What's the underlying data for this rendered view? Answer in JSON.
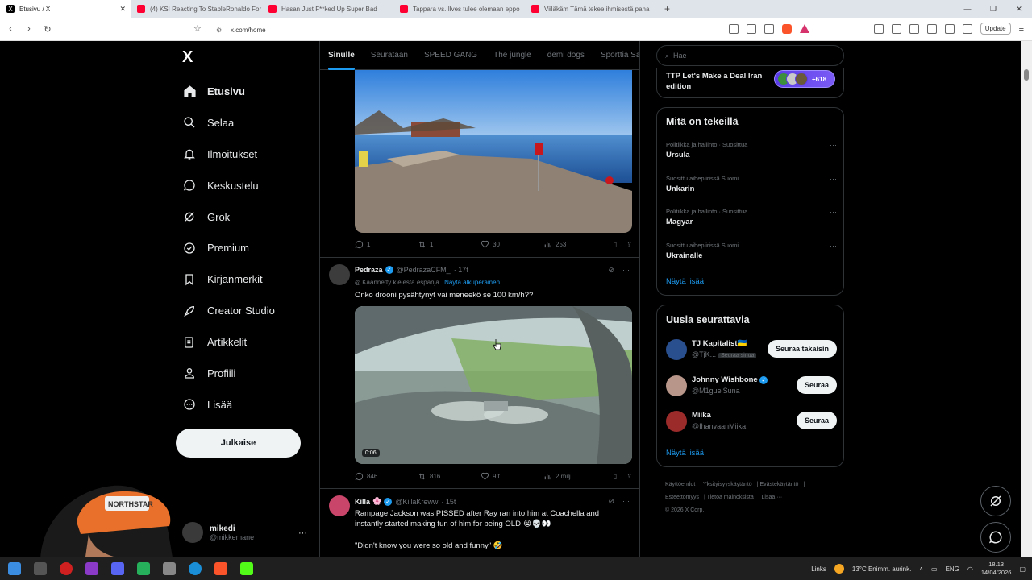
{
  "browser": {
    "tabs": [
      {
        "title": "Etusivu / X",
        "icon": "x-icon",
        "active": true
      },
      {
        "title": "(4) KSI Reacting To StableRonaldo For",
        "icon": "youtube-icon"
      },
      {
        "title": "Hasan Just F**ked Up Super Bad",
        "icon": "youtube-icon"
      },
      {
        "title": "Tappara vs. Ilves tulee olemaan eppo",
        "icon": "youtube-icon"
      },
      {
        "title": "Viiläkäm Tämä tekee ihmisestä paha",
        "icon": "youtube-icon"
      }
    ],
    "url": "x.com/home",
    "update_label": "Update"
  },
  "sidebar": {
    "logo": "X",
    "items": [
      {
        "label": "Etusivu",
        "icon": "home-icon"
      },
      {
        "label": "Selaa",
        "icon": "search-icon"
      },
      {
        "label": "Ilmoitukset",
        "icon": "bell-icon"
      },
      {
        "label": "Keskustelu",
        "icon": "chat-icon"
      },
      {
        "label": "Grok",
        "icon": "grok-icon"
      },
      {
        "label": "Premium",
        "icon": "premium-icon"
      },
      {
        "label": "Kirjanmerkit",
        "icon": "bookmark-icon"
      },
      {
        "label": "Creator Studio",
        "icon": "rocket-icon"
      },
      {
        "label": "Artikkelit",
        "icon": "article-icon"
      },
      {
        "label": "Profiili",
        "icon": "person-icon"
      },
      {
        "label": "Lisää",
        "icon": "more-circle-icon"
      }
    ],
    "post_label": "Julkaise",
    "account": {
      "name": "mikedi",
      "handle": "@mikkemane"
    }
  },
  "feed": {
    "tabs": [
      "Sinulle",
      "Seurataan",
      "SPEED GANG",
      "The jungle",
      "demi dogs",
      "Sporttia Sa"
    ],
    "post1": {
      "replies": "1",
      "reposts": "1",
      "likes": "30",
      "views": "253"
    },
    "post2": {
      "name": "Pedraza",
      "handle": "@PedrazaCFM_",
      "time": "· 17t",
      "translated_note": "Käännetty kielestä espanja",
      "show_original": "Näytä alkuperäinen",
      "text": "Onko drooni pysähtynyt vai meneekö se 100 km/h??",
      "video_time": "0:06",
      "replies": "846",
      "reposts": "816",
      "likes": "9 t.",
      "views": "2 milj."
    },
    "post3": {
      "name": "Killa",
      "handle": "@KillaKreww",
      "time": "· 15t",
      "text": "Rampage Jackson was PISSED after Ray ran into him at Coachella and instantly started making fun of him for being OLD 😭💀👀",
      "quote": "\"Didn't know you were so old and funny\" 🤣"
    }
  },
  "right": {
    "search_placeholder": "Hae",
    "spaces": {
      "title": "TTP Let's Make a Deal Iran edition",
      "count": "+618"
    },
    "trending": {
      "title": "Mitä on tekeillä",
      "items": [
        {
          "context": "Politiikka ja hallinto · Suosittua",
          "topic": "Ursula"
        },
        {
          "context": "Suosittu aihepiirissä Suomi",
          "topic": "Unkarin"
        },
        {
          "context": "Politiikka ja hallinto · Suosittua",
          "topic": "Magyar"
        },
        {
          "context": "Suosittu aihepiirissä Suomi",
          "topic": "Ukrainalle"
        }
      ],
      "show_more": "Näytä lisää"
    },
    "who_to_follow": {
      "title": "Uusia seurattavia",
      "items": [
        {
          "name": "TJ Kapitalist🇺🇦",
          "handle": "@TjK...",
          "badge": "Seuraa sinua",
          "button": "Seuraa takaisin"
        },
        {
          "name": "Johnny Wishbone",
          "handle": "@M1guelSuna",
          "button": "Seuraa"
        },
        {
          "name": "Miika",
          "handle": "@IhanvaanMiika",
          "button": "Seuraa"
        }
      ],
      "show_more": "Näytä lisää"
    },
    "footer": [
      "Käyttöehdot",
      "Yksityisyyskäytäntö",
      "Evästekäytäntö",
      "Esteettömyys",
      "Tietoa mainoksista",
      "Lisää ···",
      "© 2026 X Corp."
    ]
  },
  "taskbar": {
    "links": "Links",
    "weather": "13°C  Enimm. aurink.",
    "lang": "ENG",
    "time": "18.13",
    "date": "14/04/2026"
  }
}
